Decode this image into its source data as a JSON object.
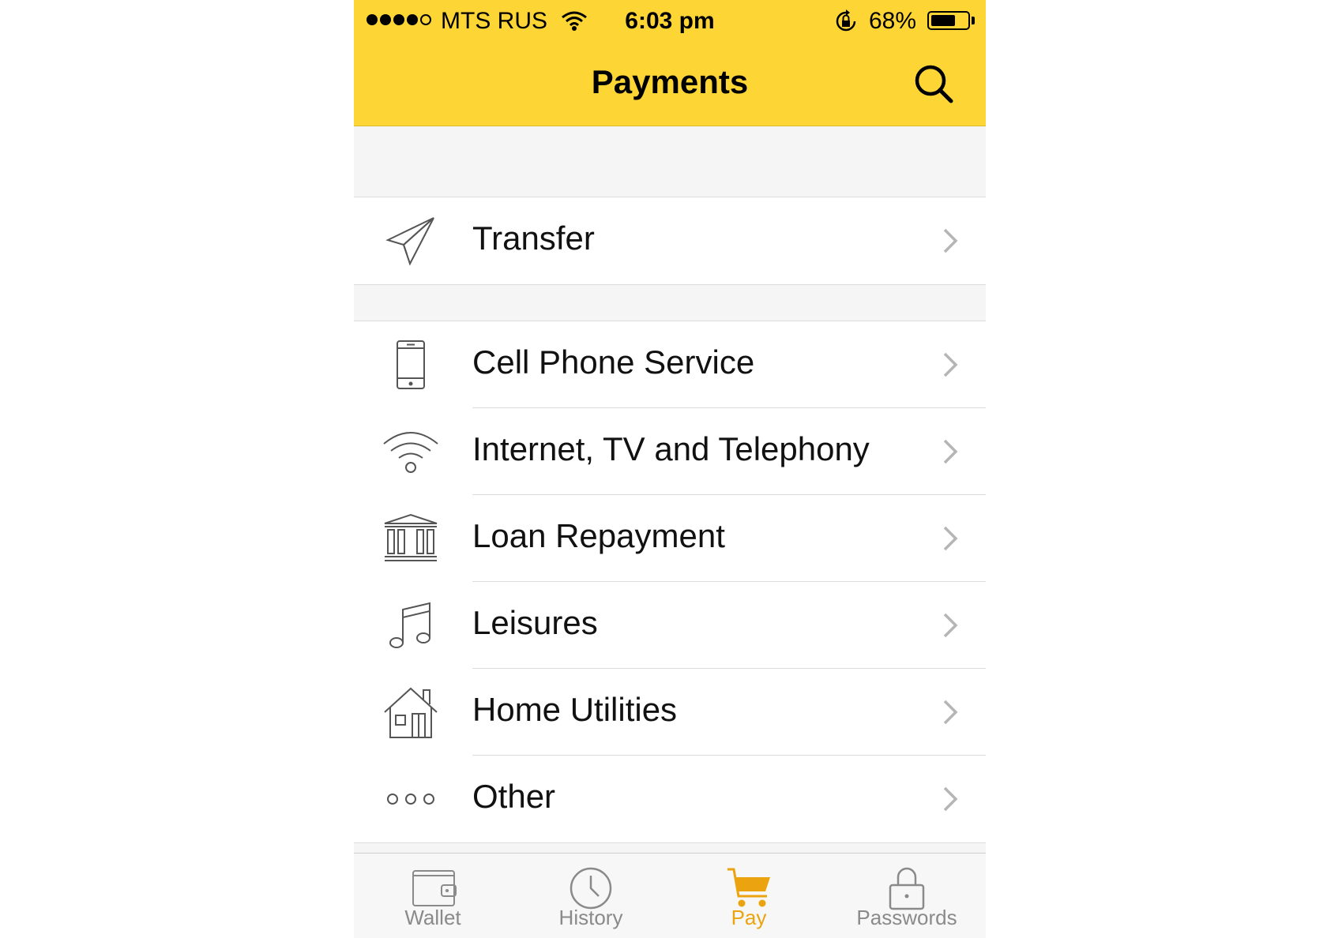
{
  "status_bar": {
    "carrier": "MTS RUS",
    "time": "6:03 pm",
    "battery_percent": "68%",
    "battery_level": 0.68,
    "signal_bars_filled": 4
  },
  "header": {
    "title": "Payments",
    "search_icon": "search-icon"
  },
  "sections": [
    {
      "items": [
        {
          "label": "Transfer",
          "icon": "paper-plane-icon"
        }
      ]
    },
    {
      "items": [
        {
          "label": "Cell Phone Service",
          "icon": "phone-icon"
        },
        {
          "label": "Internet, TV and Telephony",
          "icon": "wifi-icon"
        },
        {
          "label": "Loan Repayment",
          "icon": "bank-icon"
        },
        {
          "label": "Leisures",
          "icon": "music-note-icon"
        },
        {
          "label": "Home Utilities",
          "icon": "house-icon"
        },
        {
          "label": "Other",
          "icon": "more-dots-icon"
        }
      ]
    }
  ],
  "tabbar": {
    "tabs": [
      {
        "label": "Wallet",
        "icon": "wallet-icon",
        "active": false
      },
      {
        "label": "History",
        "icon": "clock-icon",
        "active": false
      },
      {
        "label": "Pay",
        "icon": "cart-icon",
        "active": true
      },
      {
        "label": "Passwords",
        "icon": "lock-icon",
        "active": false
      }
    ]
  },
  "colors": {
    "header_bg": "#fdd535",
    "active_tab": "#eba40f",
    "inactive_tab": "#8a8a8a",
    "background": "#f5f5f5"
  }
}
